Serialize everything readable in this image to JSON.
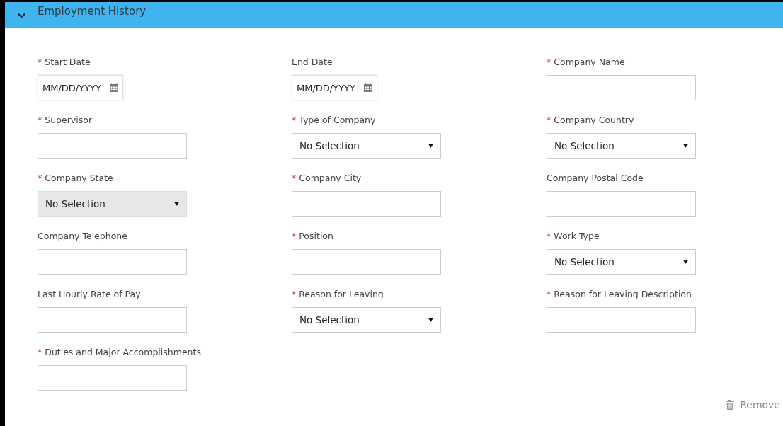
{
  "section": {
    "title": "Employment History",
    "expanded": true
  },
  "fields": [
    {
      "label": "Start Date",
      "required_mark": "*",
      "kind": "date",
      "placeholder": "MM/DD/YYYY"
    },
    {
      "label": "End Date",
      "kind": "date",
      "placeholder": "MM/DD/YYYY"
    },
    {
      "label": "Company Name",
      "required_mark": "*",
      "kind": "text"
    },
    {
      "label": "Supervisor",
      "required_mark": "*",
      "kind": "text"
    },
    {
      "label": "Type of Company",
      "required_mark": "*",
      "kind": "select",
      "value": "No Selection",
      "disabled": false
    },
    {
      "label": "Company Country",
      "required_mark": "*",
      "kind": "select",
      "value": "No Selection",
      "disabled": false
    },
    {
      "label": "Company State",
      "required_mark": "*",
      "kind": "select",
      "value": "No Selection",
      "disabled": true
    },
    {
      "label": "Company City",
      "required_mark": "*",
      "kind": "text"
    },
    {
      "label": "Company Postal Code",
      "kind": "text"
    },
    {
      "label": "Company Telephone",
      "kind": "text"
    },
    {
      "label": "Position",
      "required_mark": "*",
      "kind": "text"
    },
    {
      "label": "Work Type",
      "required_mark": "*",
      "kind": "select",
      "value": "No Selection",
      "disabled": false
    },
    {
      "label": "Last Hourly Rate of Pay",
      "kind": "text"
    },
    {
      "label": "Reason for Leaving",
      "required_mark": "*",
      "kind": "select",
      "value": "No Selection",
      "disabled": false
    },
    {
      "label": "Reason for Leaving Description",
      "required_mark": "*",
      "kind": "text"
    },
    {
      "label": "Duties and Major Accomplishments",
      "required_mark": "*",
      "kind": "text"
    }
  ],
  "remove_button": {
    "label": "Remove"
  }
}
